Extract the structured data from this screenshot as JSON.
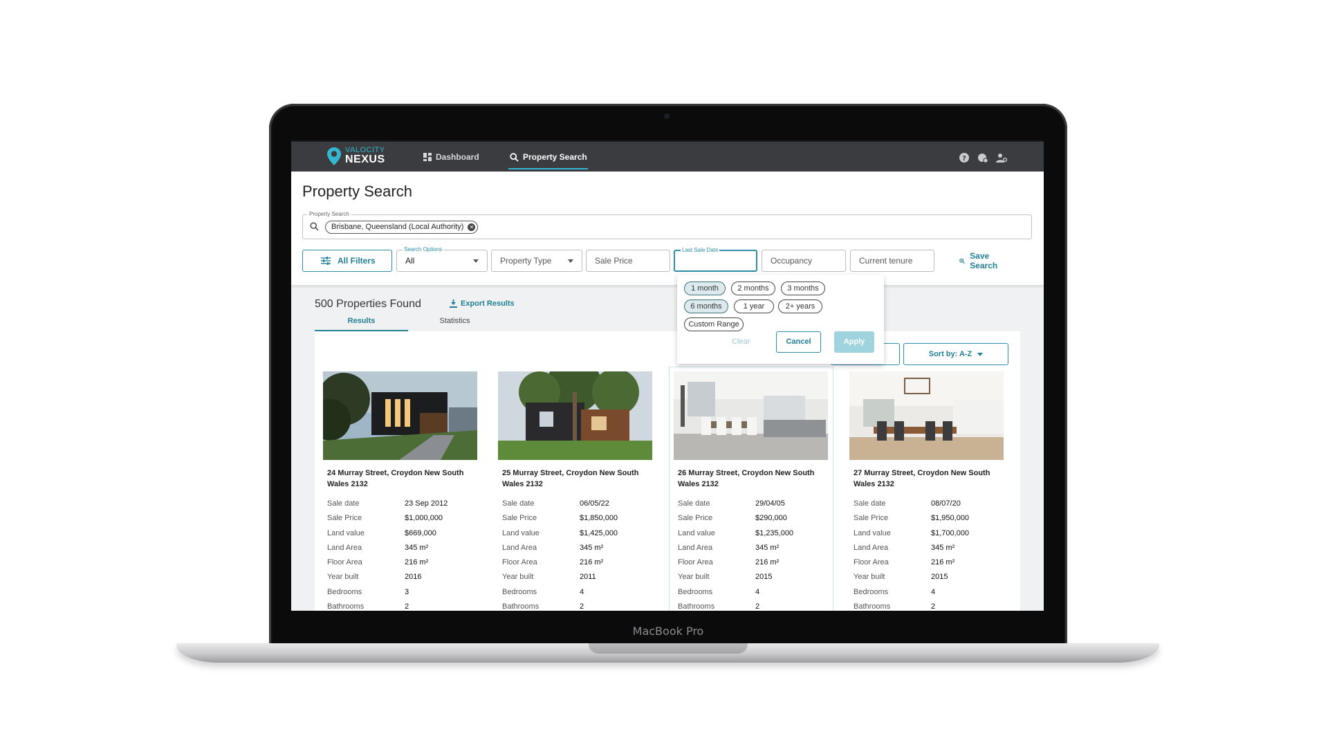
{
  "device": {
    "label": "MacBook Pro"
  },
  "app": {
    "logo_top": "VALOCITY",
    "logo_bottom": "NEXUS",
    "brand_color": "#35b7d1",
    "nav": [
      {
        "label": "Dashboard",
        "icon": "dashboard-icon"
      },
      {
        "label": "Property Search",
        "icon": "search-icon",
        "active": true
      }
    ],
    "header_icons": [
      "help-icon",
      "notifications-icon",
      "account-icon"
    ]
  },
  "page": {
    "title": "Property Search",
    "property_search": {
      "legend": "Property Search",
      "chip": "Brisbane, Queensland (Local Authority)"
    }
  },
  "filters": {
    "all_filters": "All Filters",
    "search_options_legend": "Search Options",
    "search_options_value": "All",
    "property_type": "Property Type",
    "sale_price": "Sale Price",
    "last_sale_date_legend": "Last Sale Date",
    "occupancy": "Occupancy",
    "current_tenure": "Current tenure",
    "save_search": "Save Search"
  },
  "date_dropdown": {
    "options": [
      "1 month",
      "2 months",
      "3 months",
      "6 months",
      "1 year",
      "2+ years",
      "Custom Range"
    ],
    "selected": [
      "1 month",
      "6 months"
    ],
    "clear": "Clear",
    "cancel": "Cancel",
    "apply": "Apply"
  },
  "results": {
    "count_text": "500 Properties Found",
    "export": "Export Results",
    "tabs": [
      "Results",
      "Statistics"
    ],
    "active_tab": "Results",
    "sort": "Sort by: A-Z"
  },
  "field_labels": [
    "Sale date",
    "Sale Price",
    "Land value",
    "Land Area",
    "Floor Area",
    "Year built",
    "Bedrooms",
    "Bathrooms"
  ],
  "cards": [
    {
      "address": "24 Murray Street, Croydon New South Wales 2132",
      "image": "modern-house-exterior-night",
      "values": [
        "23 Sep 2012",
        "$1,000,000",
        "$669,000",
        "345 m²",
        "216 m²",
        "2016",
        "3",
        "2"
      ]
    },
    {
      "address": "25 Murray Street, Croydon New South Wales 2132",
      "image": "modern-house-exterior-tree",
      "values": [
        "06/05/22",
        "$1,850,000",
        "$1,425,000",
        "345 m²",
        "216 m²",
        "2011",
        "4",
        "2"
      ]
    },
    {
      "address": "26 Murray Street, Croydon New South Wales 2132",
      "image": "interior-living-room",
      "values": [
        "29/04/05",
        "$290,000",
        "$1,235,000",
        "345 m²",
        "216 m²",
        "2015",
        "4",
        "2"
      ]
    },
    {
      "address": "27 Murray Street, Croydon New South Wales 2132",
      "image": "interior-dining-room",
      "values": [
        "08/07/20",
        "$1,950,000",
        "$1,700,000",
        "345 m²",
        "216 m²",
        "2015",
        "4",
        "2"
      ]
    }
  ]
}
